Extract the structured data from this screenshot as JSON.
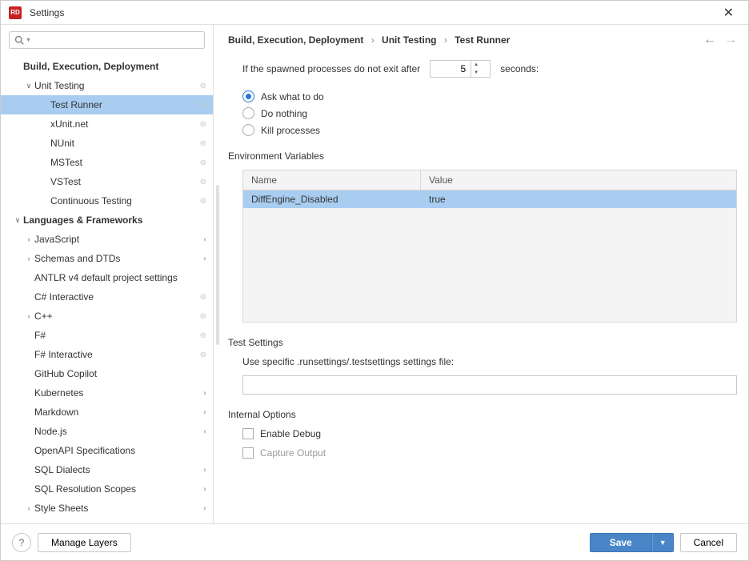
{
  "window": {
    "title": "Settings",
    "app_badge": "RD"
  },
  "search": {
    "placeholder": ""
  },
  "tree": {
    "items": [
      {
        "label": "Build, Execution, Deployment",
        "indent": 0,
        "bold": true,
        "arrow": ""
      },
      {
        "label": "Unit Testing",
        "indent": 1,
        "bold": false,
        "arrow": "∨",
        "marker": "⊜"
      },
      {
        "label": "Test Runner",
        "indent": 2,
        "bold": false,
        "arrow": "",
        "selected": true,
        "marker": "⊜"
      },
      {
        "label": "xUnit.net",
        "indent": 2,
        "bold": false,
        "arrow": "",
        "marker": "⊜"
      },
      {
        "label": "NUnit",
        "indent": 2,
        "bold": false,
        "arrow": "",
        "marker": "⊜"
      },
      {
        "label": "MSTest",
        "indent": 2,
        "bold": false,
        "arrow": "",
        "marker": "⊜"
      },
      {
        "label": "VSTest",
        "indent": 2,
        "bold": false,
        "arrow": "",
        "marker": "⊜"
      },
      {
        "label": "Continuous Testing",
        "indent": 2,
        "bold": false,
        "arrow": "",
        "marker": "⊜"
      },
      {
        "label": "Languages & Frameworks",
        "indent": 0,
        "bold": true,
        "arrow": "∨"
      },
      {
        "label": "JavaScript",
        "indent": 1,
        "bold": false,
        "arrow": "›",
        "marker": "◑"
      },
      {
        "label": "Schemas and DTDs",
        "indent": 1,
        "bold": false,
        "arrow": "›",
        "marker": "◑"
      },
      {
        "label": "ANTLR v4 default project settings",
        "indent": 1,
        "bold": false,
        "arrow": ""
      },
      {
        "label": "C# Interactive",
        "indent": 1,
        "bold": false,
        "arrow": "",
        "marker": "⊜"
      },
      {
        "label": "C++",
        "indent": 1,
        "bold": false,
        "arrow": "›",
        "marker": "⊜"
      },
      {
        "label": "F#",
        "indent": 1,
        "bold": false,
        "arrow": "",
        "marker": "⊜"
      },
      {
        "label": "F# Interactive",
        "indent": 1,
        "bold": false,
        "arrow": "",
        "marker": "⊜"
      },
      {
        "label": "GitHub Copilot",
        "indent": 1,
        "bold": false,
        "arrow": ""
      },
      {
        "label": "Kubernetes",
        "indent": 1,
        "bold": false,
        "arrow": "",
        "marker": "◑"
      },
      {
        "label": "Markdown",
        "indent": 1,
        "bold": false,
        "arrow": "",
        "marker": "◑"
      },
      {
        "label": "Node.js",
        "indent": 1,
        "bold": false,
        "arrow": "",
        "marker": "◑"
      },
      {
        "label": "OpenAPI Specifications",
        "indent": 1,
        "bold": false,
        "arrow": ""
      },
      {
        "label": "SQL Dialects",
        "indent": 1,
        "bold": false,
        "arrow": "",
        "marker": "◑"
      },
      {
        "label": "SQL Resolution Scopes",
        "indent": 1,
        "bold": false,
        "arrow": "",
        "marker": "◑"
      },
      {
        "label": "Style Sheets",
        "indent": 1,
        "bold": false,
        "arrow": "›",
        "marker": "◑"
      }
    ]
  },
  "breadcrumb": {
    "parts": [
      "Build, Execution, Deployment",
      "Unit Testing",
      "Test Runner"
    ]
  },
  "spawned": {
    "before": "If the spawned processes do not exit after",
    "value": "5",
    "after": "seconds:"
  },
  "radios": {
    "items": [
      {
        "label": "Ask what to do",
        "checked": true
      },
      {
        "label": "Do nothing",
        "checked": false
      },
      {
        "label": "Kill processes",
        "checked": false
      }
    ]
  },
  "env": {
    "title": "Environment Variables",
    "headers": {
      "name": "Name",
      "value": "Value"
    },
    "rows": [
      {
        "name": "DiffEngine_Disabled",
        "value": "true"
      }
    ]
  },
  "test_settings": {
    "title": "Test Settings",
    "label": "Use specific .runsettings/.testsettings settings file:",
    "value": ""
  },
  "internal": {
    "title": "Internal Options",
    "items": [
      {
        "label": "Enable Debug",
        "dim": false
      },
      {
        "label": "Capture Output",
        "dim": true
      }
    ]
  },
  "footer": {
    "manage": "Manage Layers",
    "save": "Save",
    "cancel": "Cancel"
  }
}
